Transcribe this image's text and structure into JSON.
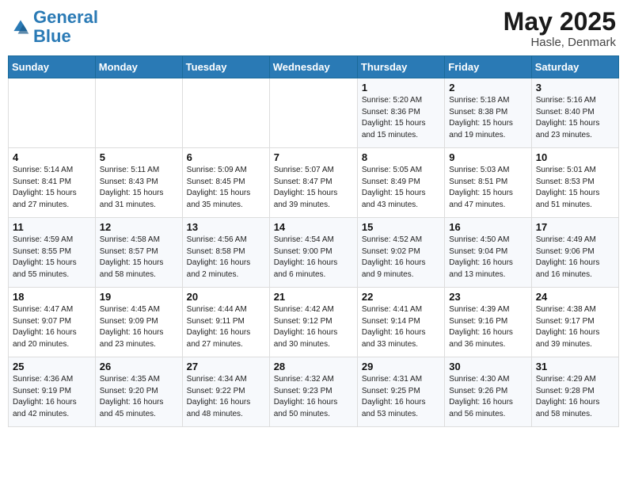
{
  "logo": {
    "text_general": "General",
    "text_blue": "Blue"
  },
  "title": "May 2025",
  "subtitle": "Hasle, Denmark",
  "days_of_week": [
    "Sunday",
    "Monday",
    "Tuesday",
    "Wednesday",
    "Thursday",
    "Friday",
    "Saturday"
  ],
  "weeks": [
    [
      {
        "day": "",
        "info": ""
      },
      {
        "day": "",
        "info": ""
      },
      {
        "day": "",
        "info": ""
      },
      {
        "day": "",
        "info": ""
      },
      {
        "day": "1",
        "info": "Sunrise: 5:20 AM\nSunset: 8:36 PM\nDaylight: 15 hours\nand 15 minutes."
      },
      {
        "day": "2",
        "info": "Sunrise: 5:18 AM\nSunset: 8:38 PM\nDaylight: 15 hours\nand 19 minutes."
      },
      {
        "day": "3",
        "info": "Sunrise: 5:16 AM\nSunset: 8:40 PM\nDaylight: 15 hours\nand 23 minutes."
      }
    ],
    [
      {
        "day": "4",
        "info": "Sunrise: 5:14 AM\nSunset: 8:41 PM\nDaylight: 15 hours\nand 27 minutes."
      },
      {
        "day": "5",
        "info": "Sunrise: 5:11 AM\nSunset: 8:43 PM\nDaylight: 15 hours\nand 31 minutes."
      },
      {
        "day": "6",
        "info": "Sunrise: 5:09 AM\nSunset: 8:45 PM\nDaylight: 15 hours\nand 35 minutes."
      },
      {
        "day": "7",
        "info": "Sunrise: 5:07 AM\nSunset: 8:47 PM\nDaylight: 15 hours\nand 39 minutes."
      },
      {
        "day": "8",
        "info": "Sunrise: 5:05 AM\nSunset: 8:49 PM\nDaylight: 15 hours\nand 43 minutes."
      },
      {
        "day": "9",
        "info": "Sunrise: 5:03 AM\nSunset: 8:51 PM\nDaylight: 15 hours\nand 47 minutes."
      },
      {
        "day": "10",
        "info": "Sunrise: 5:01 AM\nSunset: 8:53 PM\nDaylight: 15 hours\nand 51 minutes."
      }
    ],
    [
      {
        "day": "11",
        "info": "Sunrise: 4:59 AM\nSunset: 8:55 PM\nDaylight: 15 hours\nand 55 minutes."
      },
      {
        "day": "12",
        "info": "Sunrise: 4:58 AM\nSunset: 8:57 PM\nDaylight: 15 hours\nand 58 minutes."
      },
      {
        "day": "13",
        "info": "Sunrise: 4:56 AM\nSunset: 8:58 PM\nDaylight: 16 hours\nand 2 minutes."
      },
      {
        "day": "14",
        "info": "Sunrise: 4:54 AM\nSunset: 9:00 PM\nDaylight: 16 hours\nand 6 minutes."
      },
      {
        "day": "15",
        "info": "Sunrise: 4:52 AM\nSunset: 9:02 PM\nDaylight: 16 hours\nand 9 minutes."
      },
      {
        "day": "16",
        "info": "Sunrise: 4:50 AM\nSunset: 9:04 PM\nDaylight: 16 hours\nand 13 minutes."
      },
      {
        "day": "17",
        "info": "Sunrise: 4:49 AM\nSunset: 9:06 PM\nDaylight: 16 hours\nand 16 minutes."
      }
    ],
    [
      {
        "day": "18",
        "info": "Sunrise: 4:47 AM\nSunset: 9:07 PM\nDaylight: 16 hours\nand 20 minutes."
      },
      {
        "day": "19",
        "info": "Sunrise: 4:45 AM\nSunset: 9:09 PM\nDaylight: 16 hours\nand 23 minutes."
      },
      {
        "day": "20",
        "info": "Sunrise: 4:44 AM\nSunset: 9:11 PM\nDaylight: 16 hours\nand 27 minutes."
      },
      {
        "day": "21",
        "info": "Sunrise: 4:42 AM\nSunset: 9:12 PM\nDaylight: 16 hours\nand 30 minutes."
      },
      {
        "day": "22",
        "info": "Sunrise: 4:41 AM\nSunset: 9:14 PM\nDaylight: 16 hours\nand 33 minutes."
      },
      {
        "day": "23",
        "info": "Sunrise: 4:39 AM\nSunset: 9:16 PM\nDaylight: 16 hours\nand 36 minutes."
      },
      {
        "day": "24",
        "info": "Sunrise: 4:38 AM\nSunset: 9:17 PM\nDaylight: 16 hours\nand 39 minutes."
      }
    ],
    [
      {
        "day": "25",
        "info": "Sunrise: 4:36 AM\nSunset: 9:19 PM\nDaylight: 16 hours\nand 42 minutes."
      },
      {
        "day": "26",
        "info": "Sunrise: 4:35 AM\nSunset: 9:20 PM\nDaylight: 16 hours\nand 45 minutes."
      },
      {
        "day": "27",
        "info": "Sunrise: 4:34 AM\nSunset: 9:22 PM\nDaylight: 16 hours\nand 48 minutes."
      },
      {
        "day": "28",
        "info": "Sunrise: 4:32 AM\nSunset: 9:23 PM\nDaylight: 16 hours\nand 50 minutes."
      },
      {
        "day": "29",
        "info": "Sunrise: 4:31 AM\nSunset: 9:25 PM\nDaylight: 16 hours\nand 53 minutes."
      },
      {
        "day": "30",
        "info": "Sunrise: 4:30 AM\nSunset: 9:26 PM\nDaylight: 16 hours\nand 56 minutes."
      },
      {
        "day": "31",
        "info": "Sunrise: 4:29 AM\nSunset: 9:28 PM\nDaylight: 16 hours\nand 58 minutes."
      }
    ]
  ]
}
